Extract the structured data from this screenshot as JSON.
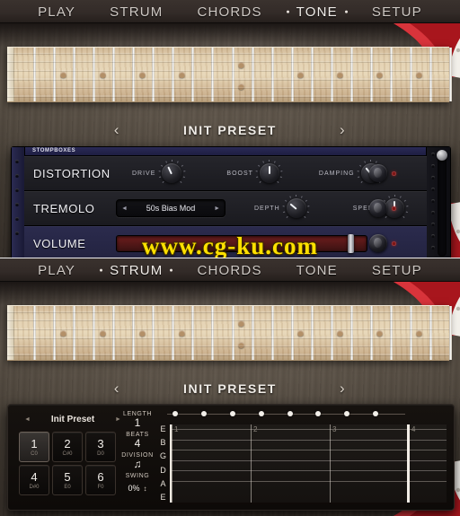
{
  "nav": {
    "items_top": [
      {
        "label": "PLAY",
        "active": false
      },
      {
        "label": "STRUM",
        "active": false
      },
      {
        "label": "CHORDS",
        "active": false
      },
      {
        "label": "TONE",
        "active": true
      },
      {
        "label": "SETUP",
        "active": false
      }
    ],
    "items_bottom": [
      {
        "label": "PLAY",
        "active": false
      },
      {
        "label": "STRUM",
        "active": true
      },
      {
        "label": "CHORDS",
        "active": false
      },
      {
        "label": "TONE",
        "active": false
      },
      {
        "label": "SETUP",
        "active": false
      }
    ]
  },
  "preset_bar": {
    "title": "INIT PRESET",
    "prev": "‹",
    "next": "›"
  },
  "stompboxes": {
    "header": "STOMPBOXES",
    "rows": [
      {
        "name": "DISTORTION",
        "knobs": [
          {
            "label": "DRIVE",
            "angle": -25
          },
          {
            "label": "BOOST",
            "angle": 0
          },
          {
            "label": "DAMPING",
            "angle": -40
          }
        ]
      },
      {
        "name": "TREMOLO",
        "dropdown": {
          "value": "50s Bias Mod",
          "prev": "◄",
          "next": "►"
        },
        "knobs": [
          {
            "label": "DEPTH",
            "angle": -50
          },
          {
            "label": "SPEED",
            "angle": 0
          }
        ]
      },
      {
        "name": "VOLUME",
        "slider": {
          "position_pct": 95
        }
      }
    ]
  },
  "strum_editor": {
    "preset": {
      "value": "Init Preset",
      "prev": "◄",
      "next": "►"
    },
    "pads": [
      {
        "num": "1",
        "note": "C0",
        "selected": true
      },
      {
        "num": "2",
        "note": "C#0",
        "selected": false
      },
      {
        "num": "3",
        "note": "D0",
        "selected": false
      },
      {
        "num": "4",
        "note": "D#0",
        "selected": false
      },
      {
        "num": "5",
        "note": "E0",
        "selected": false
      },
      {
        "num": "6",
        "note": "F0",
        "selected": false
      }
    ],
    "params": [
      {
        "label": "LENGTH",
        "value": "1"
      },
      {
        "label": "BEATS",
        "value": "4"
      },
      {
        "label": "DIVISION",
        "value": "♫"
      },
      {
        "label": "SWING",
        "value": "0%"
      }
    ],
    "swing_drag_icon": "↕",
    "steps_count": 8,
    "string_labels": [
      "E",
      "B",
      "G",
      "D",
      "A",
      "E"
    ],
    "beat_numbers": [
      "1",
      "2",
      "3",
      "4"
    ]
  },
  "fretboard": {
    "fret_count": 22,
    "inlay_frets": [
      3,
      5,
      7,
      9,
      12,
      15,
      17,
      19,
      21
    ],
    "string_count": 6
  },
  "watermark": {
    "text": "www.cg-ku.com"
  },
  "colors": {
    "accent_blue": "#2a2a55",
    "led_red": "#7d1616",
    "body_red": "#b11b22",
    "wood": "#6f6355",
    "watermark_yellow": "#ffe000"
  }
}
